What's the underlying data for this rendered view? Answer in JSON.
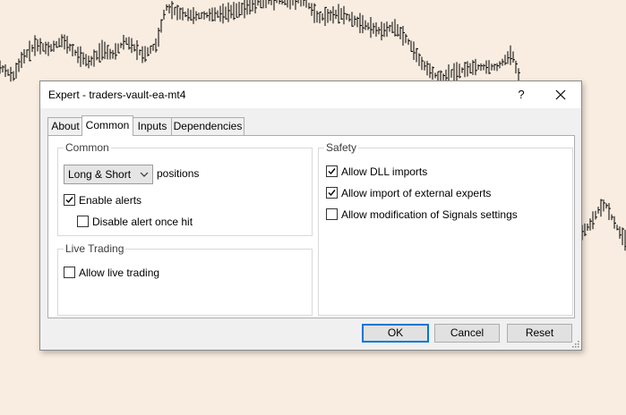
{
  "dialog": {
    "title": "Expert - traders-vault-ea-mt4",
    "help_label": "?",
    "close_icon": "close-icon"
  },
  "tabs": [
    {
      "label": "About",
      "active": false
    },
    {
      "label": "Common",
      "active": true
    },
    {
      "label": "Inputs",
      "active": false
    },
    {
      "label": "Dependencies",
      "active": false
    }
  ],
  "common_group": {
    "title": "Common",
    "positions_value": "Long & Short",
    "positions_suffix": "positions",
    "enable_alerts": {
      "label": "Enable alerts",
      "checked": true
    },
    "disable_alert_once_hit": {
      "label": "Disable alert once hit",
      "checked": false
    }
  },
  "live_trading_group": {
    "title": "Live Trading",
    "allow_live_trading": {
      "label": "Allow live trading",
      "checked": false
    }
  },
  "safety_group": {
    "title": "Safety",
    "allow_dll_imports": {
      "label": "Allow DLL imports",
      "checked": true
    },
    "allow_external_experts": {
      "label": "Allow import of external experts",
      "checked": true
    },
    "allow_signals_modification": {
      "label": "Allow modification of Signals settings",
      "checked": false
    }
  },
  "buttons": {
    "ok": "OK",
    "cancel": "Cancel",
    "reset": "Reset"
  },
  "colors": {
    "chart_background": "#f8ede0",
    "candle": "#000000",
    "focus_border": "#0078d7"
  }
}
